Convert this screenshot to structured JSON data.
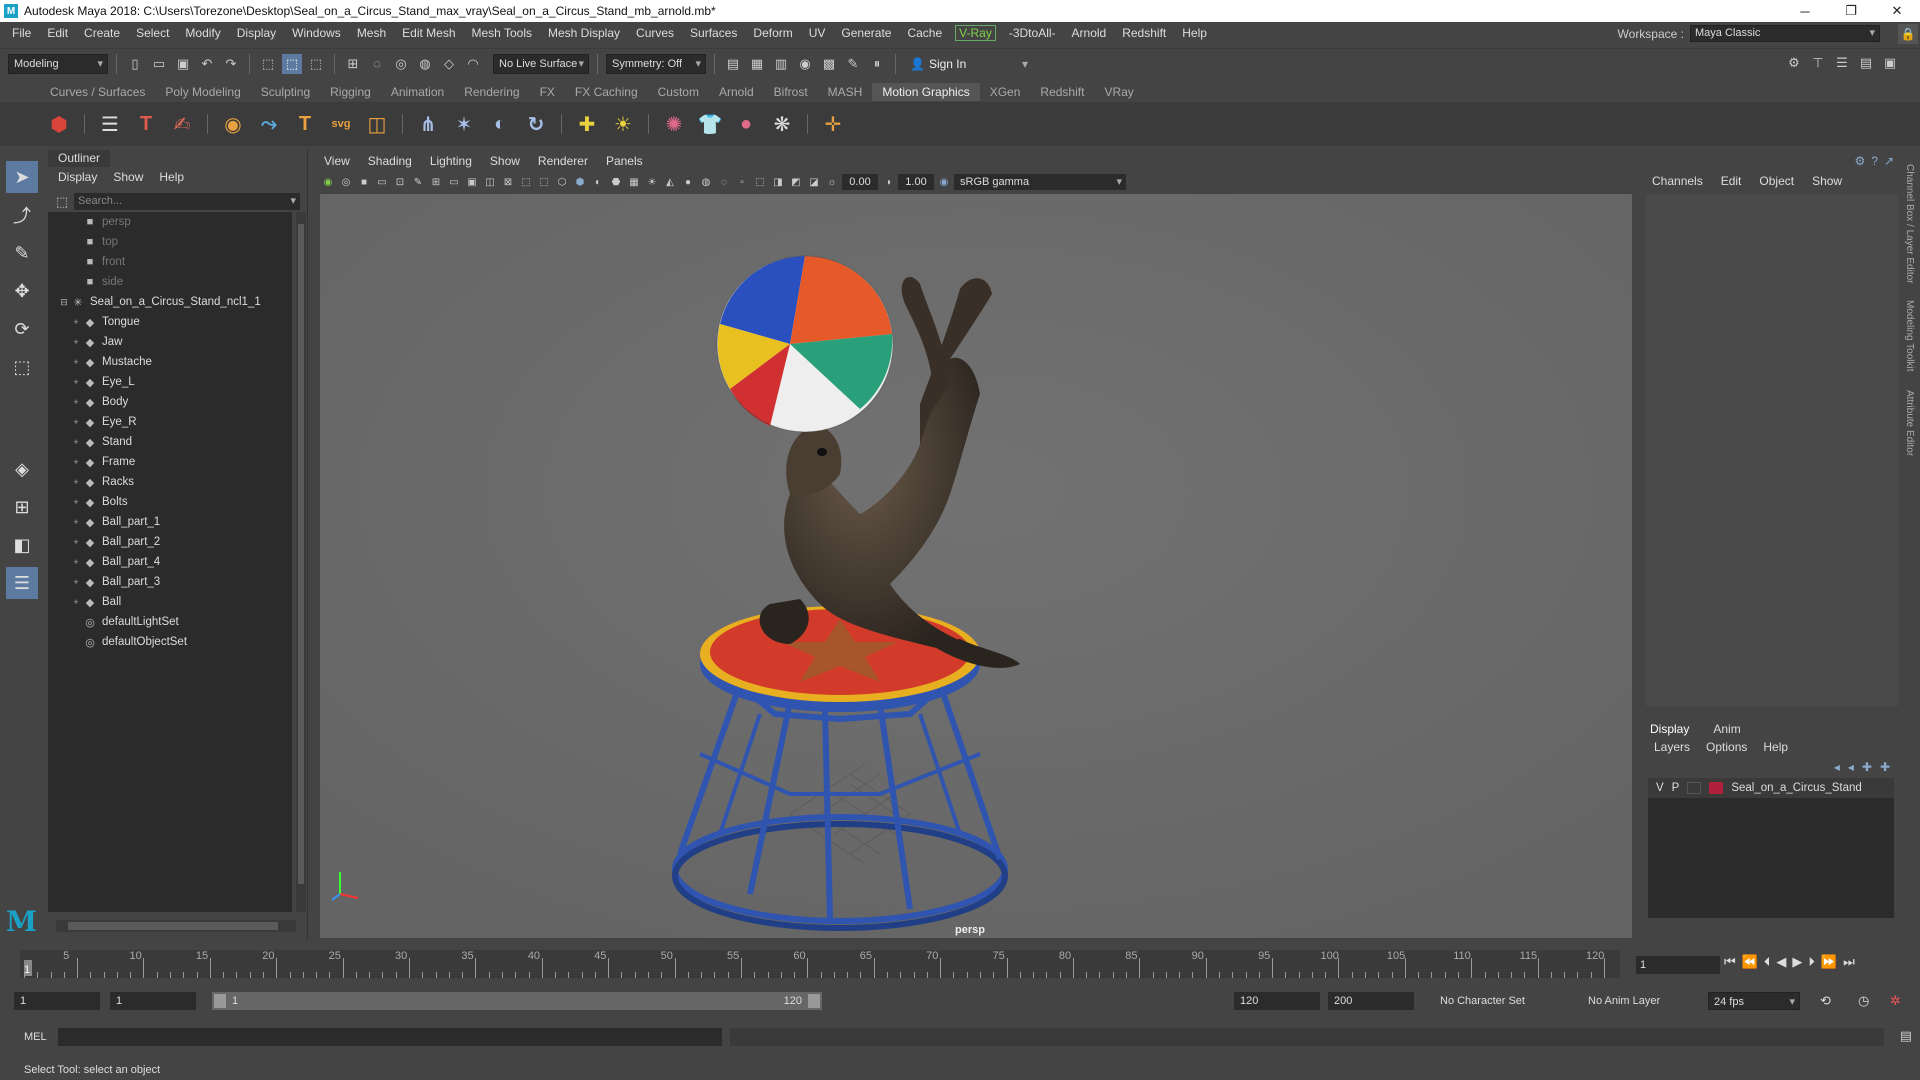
{
  "window": {
    "title": "Autodesk Maya 2018: C:\\Users\\Torezone\\Desktop\\Seal_on_a_Circus_Stand_max_vray\\Seal_on_a_Circus_Stand_mb_arnold.mb*",
    "app_icon": "M"
  },
  "menus": [
    "File",
    "Edit",
    "Create",
    "Select",
    "Modify",
    "Display",
    "Windows",
    "Mesh",
    "Edit Mesh",
    "Mesh Tools",
    "Mesh Display",
    "Curves",
    "Surfaces",
    "Deform",
    "UV",
    "Generate",
    "Cache",
    "V-Ray",
    "-3DtoAll-",
    "Arnold",
    "Redshift",
    "Help"
  ],
  "workspace": {
    "label": "Workspace :",
    "value": "Maya Classic"
  },
  "statusline": {
    "mode": "Modeling",
    "live_surface": "No Live Surface",
    "symmetry": "Symmetry: Off",
    "signin": "Sign In"
  },
  "shelf_tabs": [
    "Curves / Surfaces",
    "Poly Modeling",
    "Sculpting",
    "Rigging",
    "Animation",
    "Rendering",
    "FX",
    "FX Caching",
    "Custom",
    "Arnold",
    "Bifrost",
    "MASH",
    "Motion Graphics",
    "XGen",
    "Redshift",
    "VRay"
  ],
  "shelf_active": "Motion Graphics",
  "outliner": {
    "tab": "Outliner",
    "menu": [
      "Display",
      "Show",
      "Help"
    ],
    "search_placeholder": "Search...",
    "cameras": [
      "persp",
      "top",
      "front",
      "side"
    ],
    "root": "Seal_on_a_Circus_Stand_ncl1_1",
    "children": [
      "Tongue",
      "Jaw",
      "Mustache",
      "Eye_L",
      "Body",
      "Eye_R",
      "Stand",
      "Frame",
      "Racks",
      "Bolts",
      "Ball_part_1",
      "Ball_part_2",
      "Ball_part_4",
      "Ball_part_3",
      "Ball"
    ],
    "sets": [
      "defaultLightSet",
      "defaultObjectSet"
    ]
  },
  "viewport": {
    "menu": [
      "View",
      "Shading",
      "Lighting",
      "Show",
      "Renderer",
      "Panels"
    ],
    "exposure": "0.00",
    "gamma": "1.00",
    "color_space": "sRGB gamma",
    "camera": "persp"
  },
  "channelbox": {
    "menu": [
      "Channels",
      "Edit",
      "Object",
      "Show"
    ]
  },
  "sidetabs": [
    "Channel Box / Layer Editor",
    "Modeling Toolkit",
    "Attribute Editor"
  ],
  "layers": {
    "tabs": [
      "Display",
      "Anim"
    ],
    "menu": [
      "Layers",
      "Options",
      "Help"
    ],
    "rows": [
      {
        "v": "V",
        "p": "P",
        "name": "Seal_on_a_Circus_Stand",
        "color": "#b0203a"
      }
    ]
  },
  "timeline": {
    "ticks": [
      "5",
      "10",
      "15",
      "20",
      "25",
      "30",
      "35",
      "40",
      "45",
      "50",
      "55",
      "60",
      "65",
      "70",
      "75",
      "80",
      "85",
      "90",
      "95",
      "100",
      "105",
      "110",
      "115",
      "120"
    ],
    "current": "1",
    "current_field": "1"
  },
  "range": {
    "start": "1",
    "start2": "1",
    "slider_start": "1",
    "slider_end": "120",
    "end": "120",
    "end2": "200",
    "char_set": "No Character Set",
    "anim_layer": "No Anim Layer",
    "fps": "24 fps"
  },
  "cmd": {
    "lang": "MEL"
  },
  "help": "Select Tool: select an object"
}
